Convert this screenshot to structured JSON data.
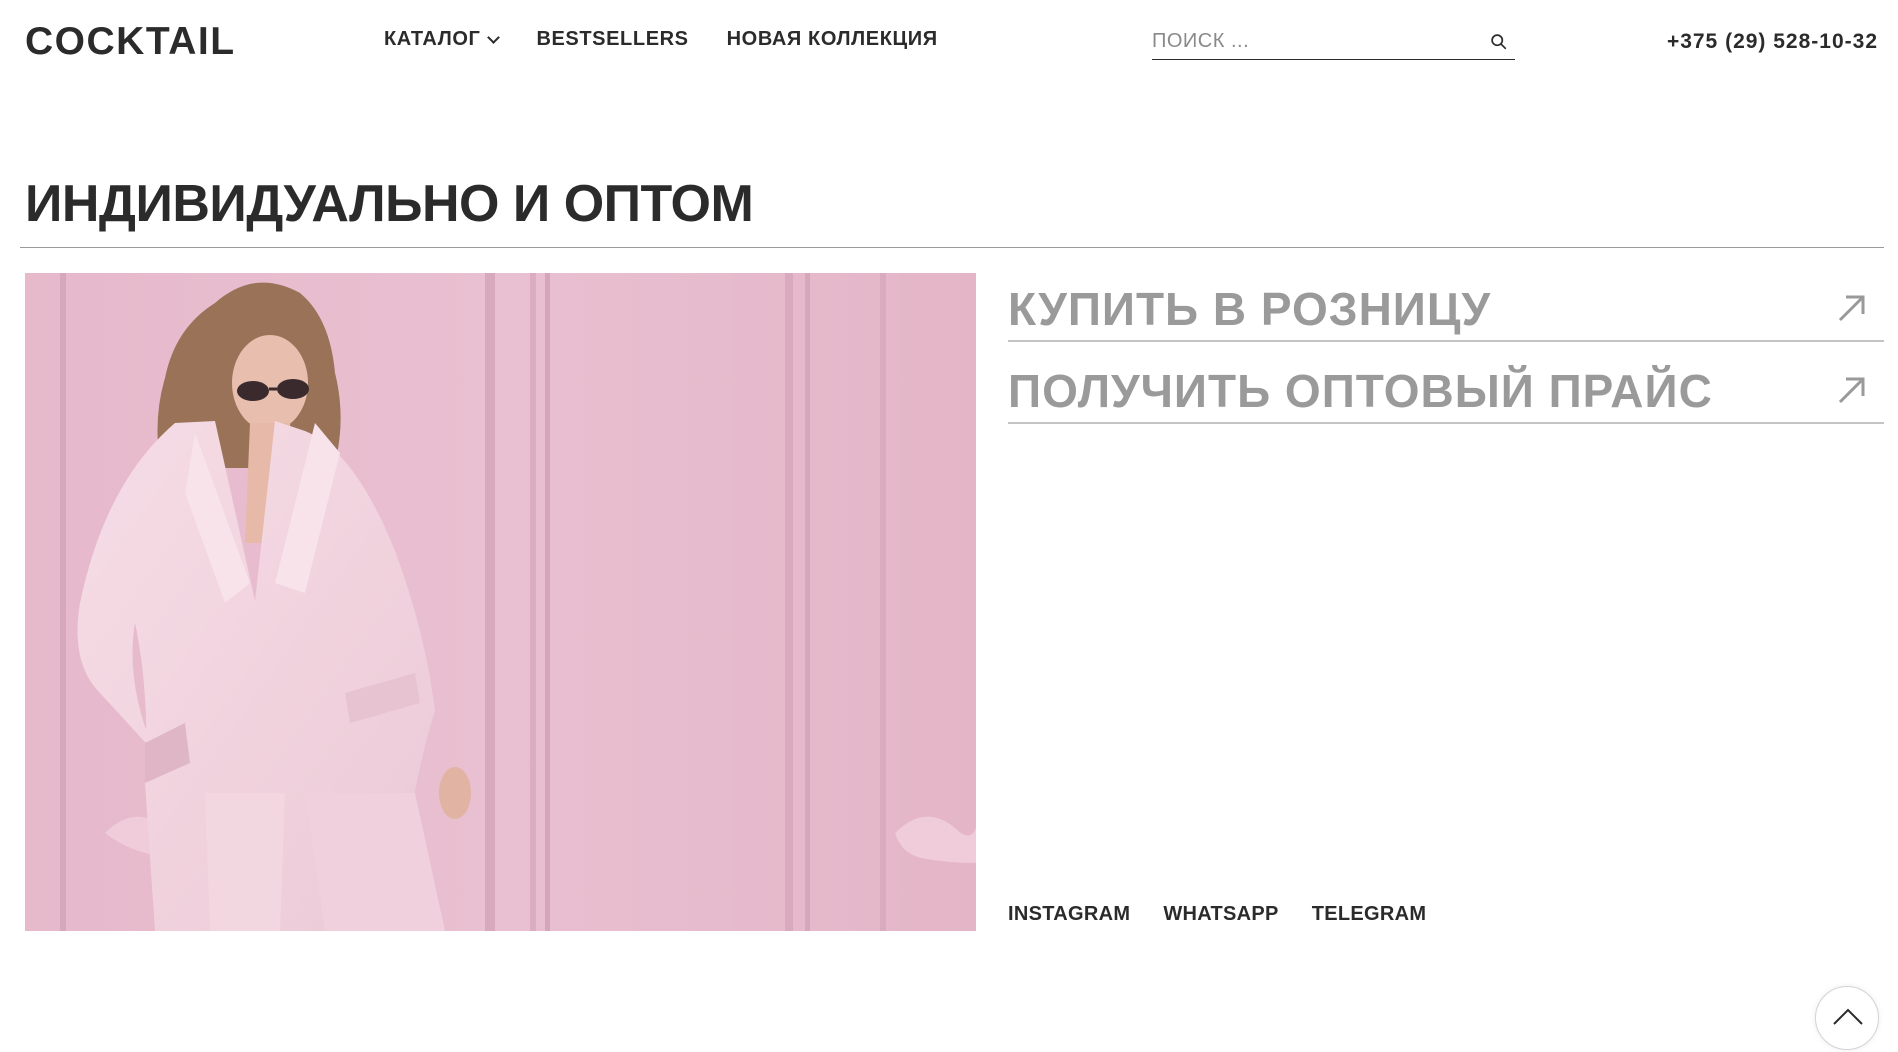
{
  "header": {
    "logo": "COCKTAIL",
    "nav": [
      {
        "label": "КАТАЛОГ",
        "icon": "chevron-down-icon"
      },
      {
        "label": "BESTSELLERS"
      },
      {
        "label": "НОВАЯ КОЛЛЕКЦИЯ"
      }
    ],
    "search": {
      "placeholder": "ПОИСК ...",
      "value": "",
      "icon": "search-icon"
    },
    "phone": "+375 (29) 528-10-32"
  },
  "main": {
    "title": "ИНДИВИДУАЛЬНО И ОПТОМ",
    "hero_image": {
      "icon": "model-photo"
    },
    "options": [
      {
        "label": "КУПИТЬ В РОЗНИЦУ",
        "icon": "arrow-up-right-icon"
      },
      {
        "label": "ПОЛУЧИТЬ ОПТОВЫЙ ПРАЙС",
        "icon": "arrow-up-right-icon"
      }
    ],
    "socials": [
      "INSTAGRAM",
      "WHATSAPP",
      "TELEGRAM"
    ]
  },
  "scroll_top": {
    "icon": "chevron-up-icon"
  },
  "colors": {
    "text": "#2b2b2b",
    "muted": "#9a9a9a",
    "hero_bg": "#e4b8c9",
    "suit": "#f1d3de"
  }
}
